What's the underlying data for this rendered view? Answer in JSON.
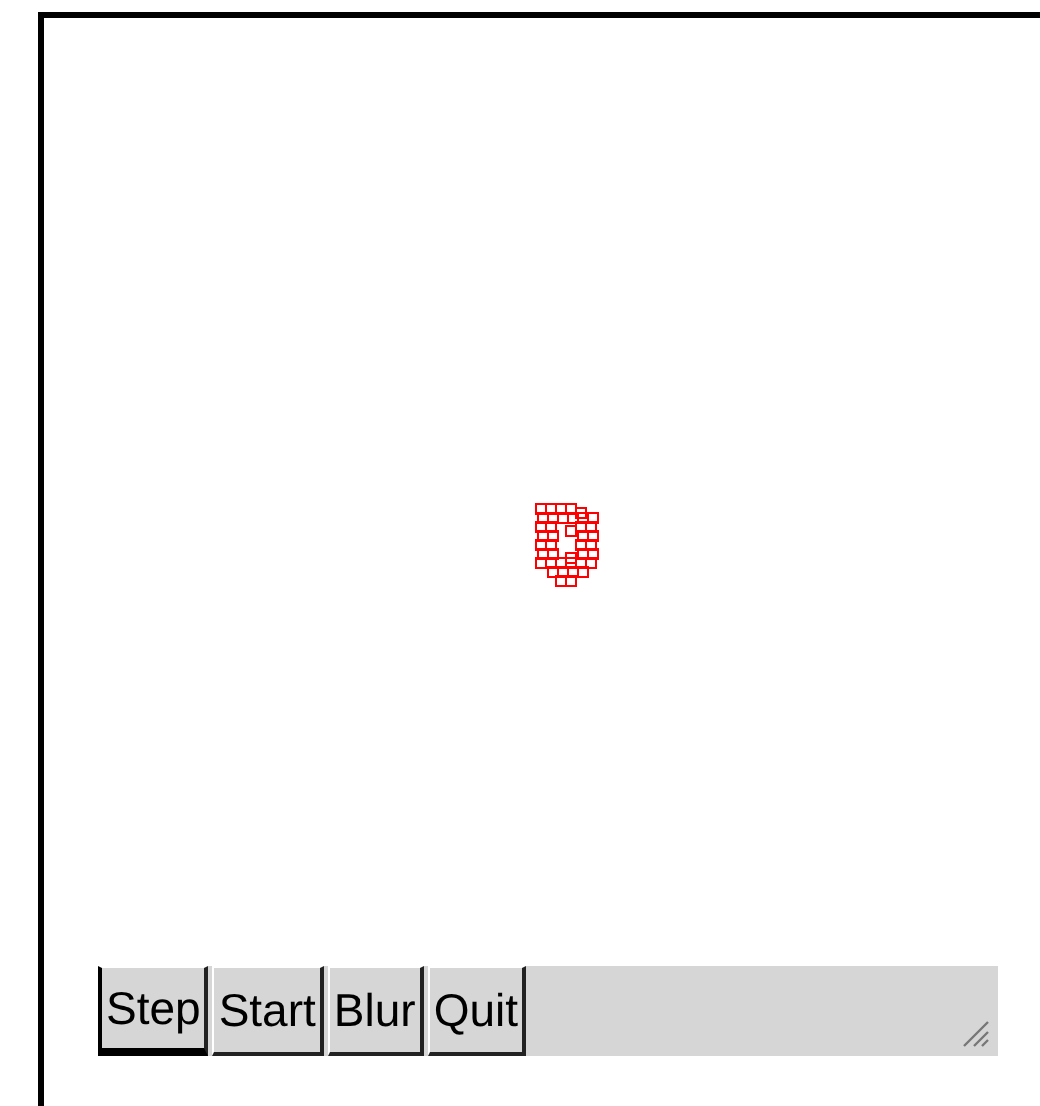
{
  "buttons": [
    {
      "label": "Step",
      "focused": true
    },
    {
      "label": "Start",
      "focused": false
    },
    {
      "label": "Blur",
      "focused": false
    },
    {
      "label": "Quit",
      "focused": false
    }
  ]
}
